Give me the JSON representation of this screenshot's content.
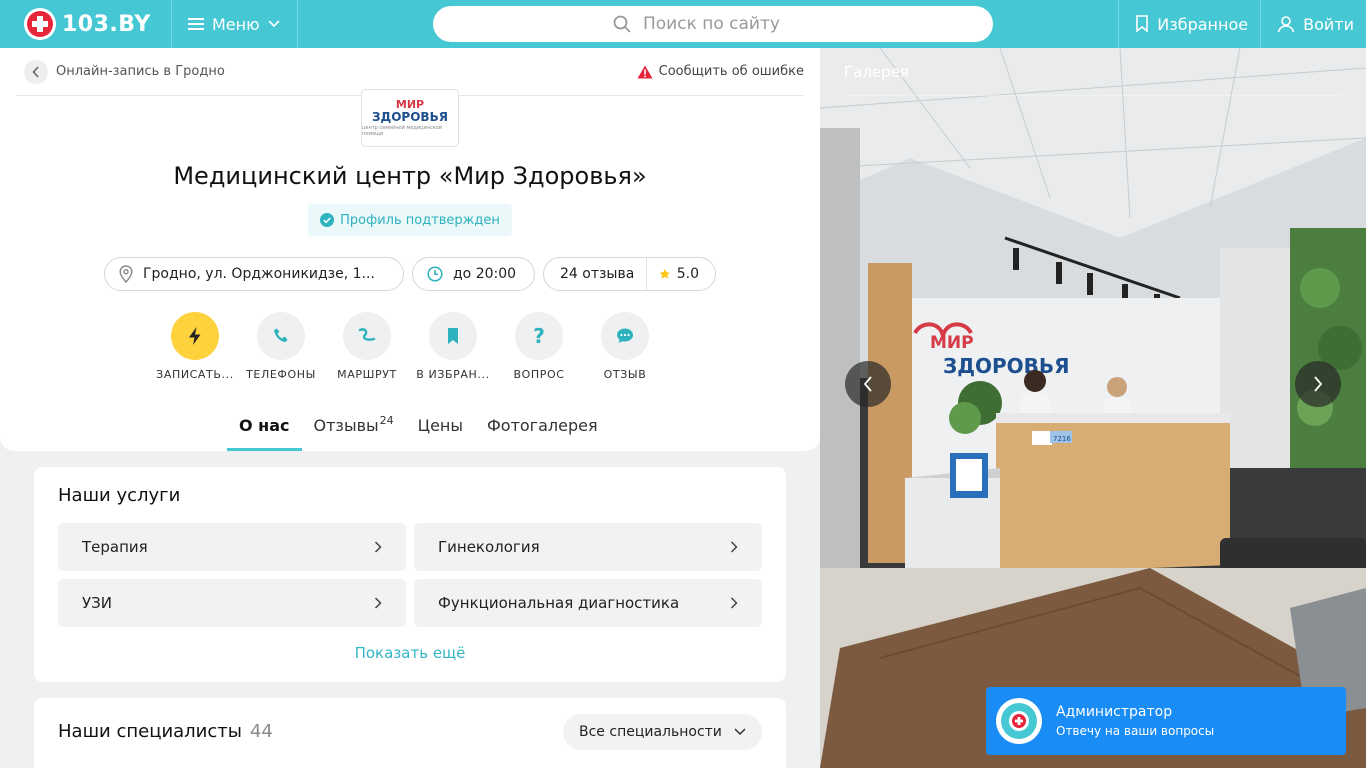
{
  "header": {
    "logo_text": "103.BY",
    "menu_label": "Меню",
    "search_placeholder": "Поиск по сайту",
    "favorites_label": "Избранное",
    "login_label": "Войти"
  },
  "breadcrumb": {
    "back_label": "Онлайн-запись в Гродно",
    "report_label": "Сообщить об ошибке"
  },
  "org": {
    "logo_line1": "МИР",
    "logo_line2": "ЗДОРОВЬЯ",
    "logo_line3": "центр семейной медицинской помощи",
    "title": "Медицинский центр «Мир Здоровья»",
    "verified_label": "Профиль подтвержден",
    "address": "Гродно, ул. Орджоникидзе, 1...",
    "hours": "до 20:00",
    "reviews_count": "24 отзыва",
    "rating": "5.0"
  },
  "actions": [
    {
      "label": "ЗАПИСАТЬ..."
    },
    {
      "label": "ТЕЛЕФОНЫ"
    },
    {
      "label": "МАРШРУТ"
    },
    {
      "label": "В ИЗБРАН..."
    },
    {
      "label": "ВОПРОС"
    },
    {
      "label": "ОТЗЫВ"
    }
  ],
  "tabs": [
    {
      "label": "О нас"
    },
    {
      "label": "Отзывы",
      "badge": "24"
    },
    {
      "label": "Цены"
    },
    {
      "label": "Фотогалерея"
    }
  ],
  "services": {
    "title": "Наши услуги",
    "items": [
      "Терапия",
      "Гинекология",
      "УЗИ",
      "Функциональная диагностика"
    ],
    "show_more": "Показать ещё"
  },
  "specialists": {
    "title": "Наши специалисты",
    "count": "44",
    "filter": "Все специальности"
  },
  "gallery": {
    "title": "Галерея",
    "sign_line1": "МИР",
    "sign_line2": "ЗДОРОВЬЯ",
    "desk_number": "7216"
  },
  "chat": {
    "name": "Администратор",
    "subtitle": "Отвечу на ваши вопросы"
  },
  "colors": {
    "brand": "#46c8d4",
    "accent_red": "#e6243a",
    "action_primary": "#fdd23c",
    "chat_blue": "#1a8cf5"
  }
}
